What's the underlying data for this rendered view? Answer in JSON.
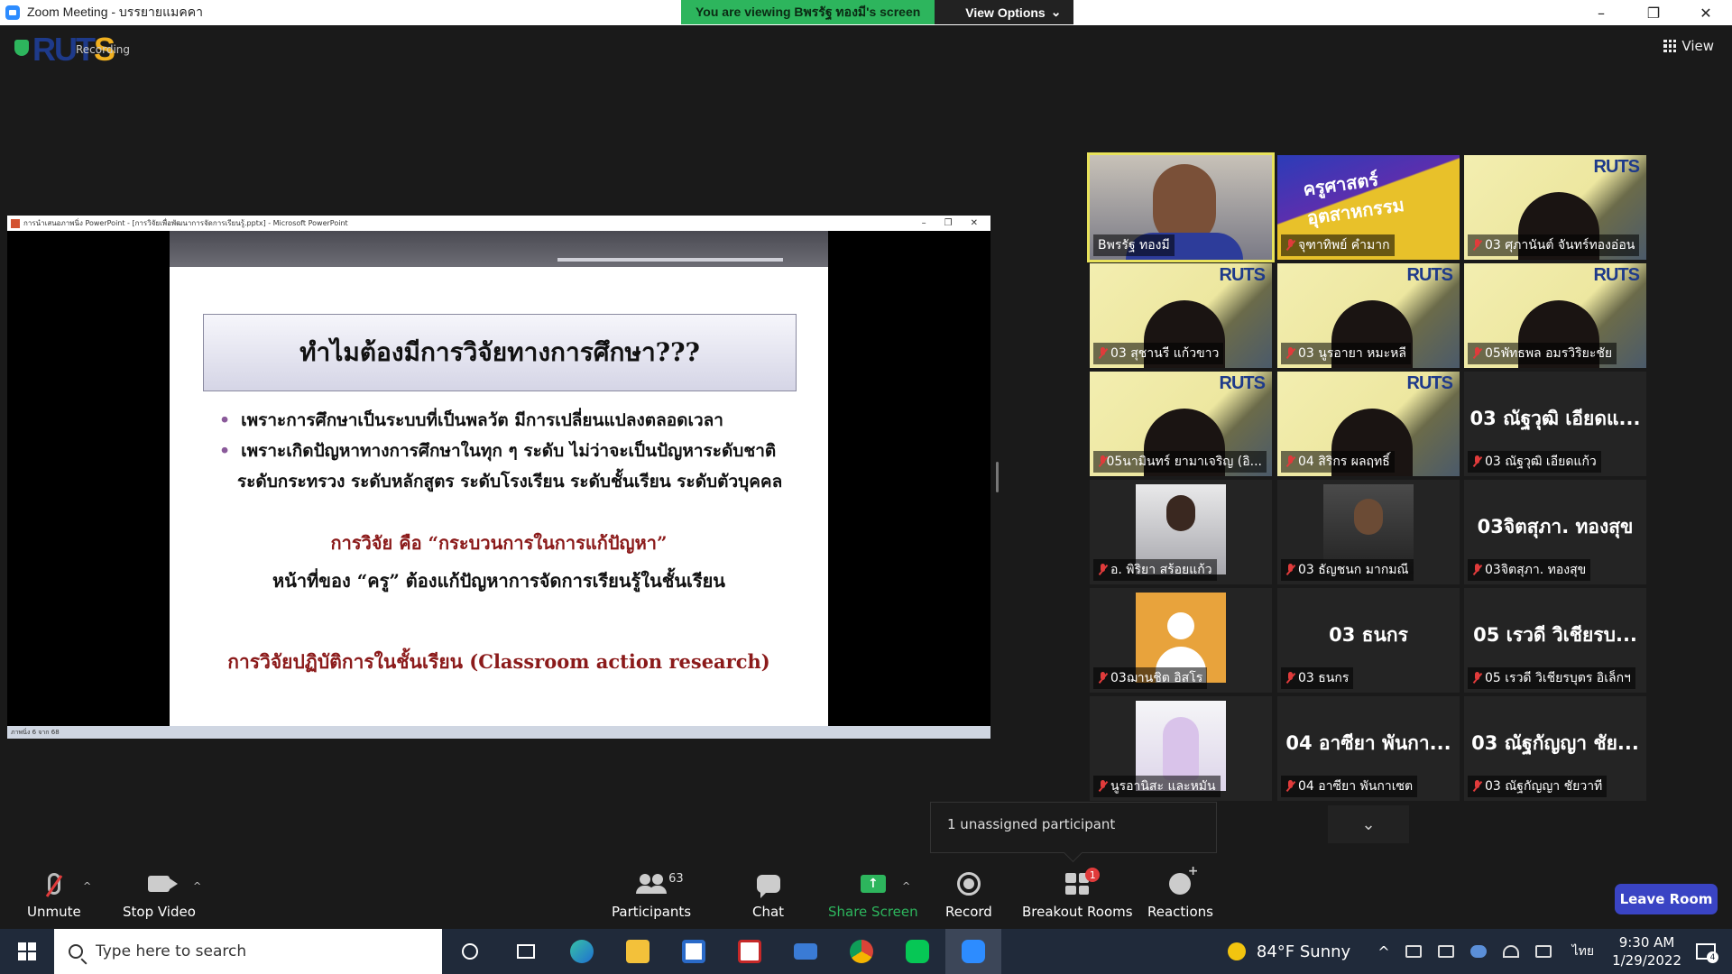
{
  "window": {
    "title": "Zoom Meeting - บรรยายแมคคา",
    "viewing_banner": "You are viewing Bพรรัฐ ทองมี's screen",
    "view_options": "View Options",
    "controls": [
      "–",
      "❐",
      "✕"
    ]
  },
  "top": {
    "recording_label": "Recording",
    "logo_text": "RUTS",
    "view_label": "View"
  },
  "ppt": {
    "window_title": "การนำเสนอภาพนิ่ง PowerPoint - [การวิจัยเพื่อพัฒนาการจัดการเรียนรู้.pptx] - Microsoft PowerPoint",
    "status": "ภาพนิ่ง 6 จาก 68",
    "slide": {
      "heading": "ทำไมต้องมีการวิจัยทางการศึกษา???",
      "bullets": [
        "เพราะการศึกษาเป็นระบบที่เป็นพลวัต มีการเปลี่ยนแปลงตลอดเวลา",
        "เพราะเกิดปัญหาทางการศึกษาในทุก ๆ ระดับ ไม่ว่าจะเป็นปัญหาระดับชาติ"
      ],
      "bullet_cont": "ระดับกระทรวง ระดับหลักสูตร ระดับโรงเรียน ระดับชั้นเรียน ระดับตัวบุคคล",
      "definition": "การวิจัย คือ “กระบวนการในการแก้ปัญหา”",
      "duty": "หน้าที่ของ “ครู” ต้องแก้ปัญหาการจัดการเรียนรู้ในชั้นเรียน",
      "car": "การวิจัยปฏิบัติการในชั้นเรียน (Classroom action research)"
    }
  },
  "participants": [
    {
      "name": "Bพรรัฐ ทองมี",
      "type": "cam",
      "active": true,
      "muted": false
    },
    {
      "name": "จุฑาทิพย์ คำมาก",
      "type": "cover",
      "cover_text": "ครูศาสตร์ อุตสาหกรรม",
      "muted": true
    },
    {
      "name": "03 ศุภานันต์ จันทร์ทองอ่อน",
      "type": "slide",
      "muted": true
    },
    {
      "name": "03 สุชานรี แก้วขาว",
      "type": "slide",
      "muted": true
    },
    {
      "name": "03 นูรอายา หมะหลี",
      "type": "slide",
      "muted": true
    },
    {
      "name": "05พัทธพล อมรวิริยะชัย",
      "type": "slide",
      "muted": true
    },
    {
      "name": "05นามินทร์ ยามาเจริญ (อิ...",
      "type": "slide",
      "muted": true
    },
    {
      "name": "04 สิริกร ผลฤทธิ์",
      "type": "slide",
      "muted": true
    },
    {
      "name": "03 ณัฐวุฒิ เอียดแก้ว",
      "type": "text",
      "big": "03 ณัฐวุฒิ เอียดแ...",
      "muted": true
    },
    {
      "name": "อ. พิริยา สร้อยแก้ว",
      "type": "photo",
      "photo": "p1",
      "muted": true
    },
    {
      "name": "03 ธัญชนก มากมณี",
      "type": "photo",
      "photo": "p2",
      "muted": true
    },
    {
      "name": "03จิตสุภา. ทองสุข",
      "type": "text",
      "big": "03จิตสุภา. ทองสุข",
      "muted": true
    },
    {
      "name": "03ฌานชิต อิสโร",
      "type": "photo",
      "photo": "p3",
      "muted": true
    },
    {
      "name": "03 ธนกร",
      "type": "text",
      "big": "03 ธนกร",
      "muted": true
    },
    {
      "name": "05 เรวดี วิเชียรบุตร อิเล็กฯ",
      "type": "text",
      "big": "05 เรวดี วิเชียรบ...",
      "muted": true
    },
    {
      "name": "นูรอานิสะ และหมัน",
      "type": "photo",
      "photo": "p4",
      "muted": true
    },
    {
      "name": "04 อาซียา พันกาเซต",
      "type": "text",
      "big": "04 อาซียา พันกา...",
      "muted": true
    },
    {
      "name": "03 ณัฐกัญญา ชัยวาที",
      "type": "text",
      "big": "03 ณัฐกัญญา ชัย...",
      "muted": true
    }
  ],
  "toast": {
    "text": "1 unassigned participant"
  },
  "toolbar": {
    "unmute": "Unmute",
    "stop_video": "Stop Video",
    "participants": "Participants",
    "participants_count": "63",
    "chat": "Chat",
    "share_screen": "Share Screen",
    "record": "Record",
    "breakout_rooms": "Breakout Rooms",
    "breakout_badge": "1",
    "reactions": "Reactions",
    "leave_room": "Leave Room"
  },
  "taskbar": {
    "search_placeholder": "Type here to search",
    "weather": "84°F  Sunny",
    "language": "ไทย",
    "time": "9:30 AM",
    "date": "1/29/2022",
    "notification_count": "4"
  },
  "colors": {
    "share_green": "#2db55d",
    "leave_blue": "#3a44c4",
    "active_speaker": "#e8e25a"
  }
}
